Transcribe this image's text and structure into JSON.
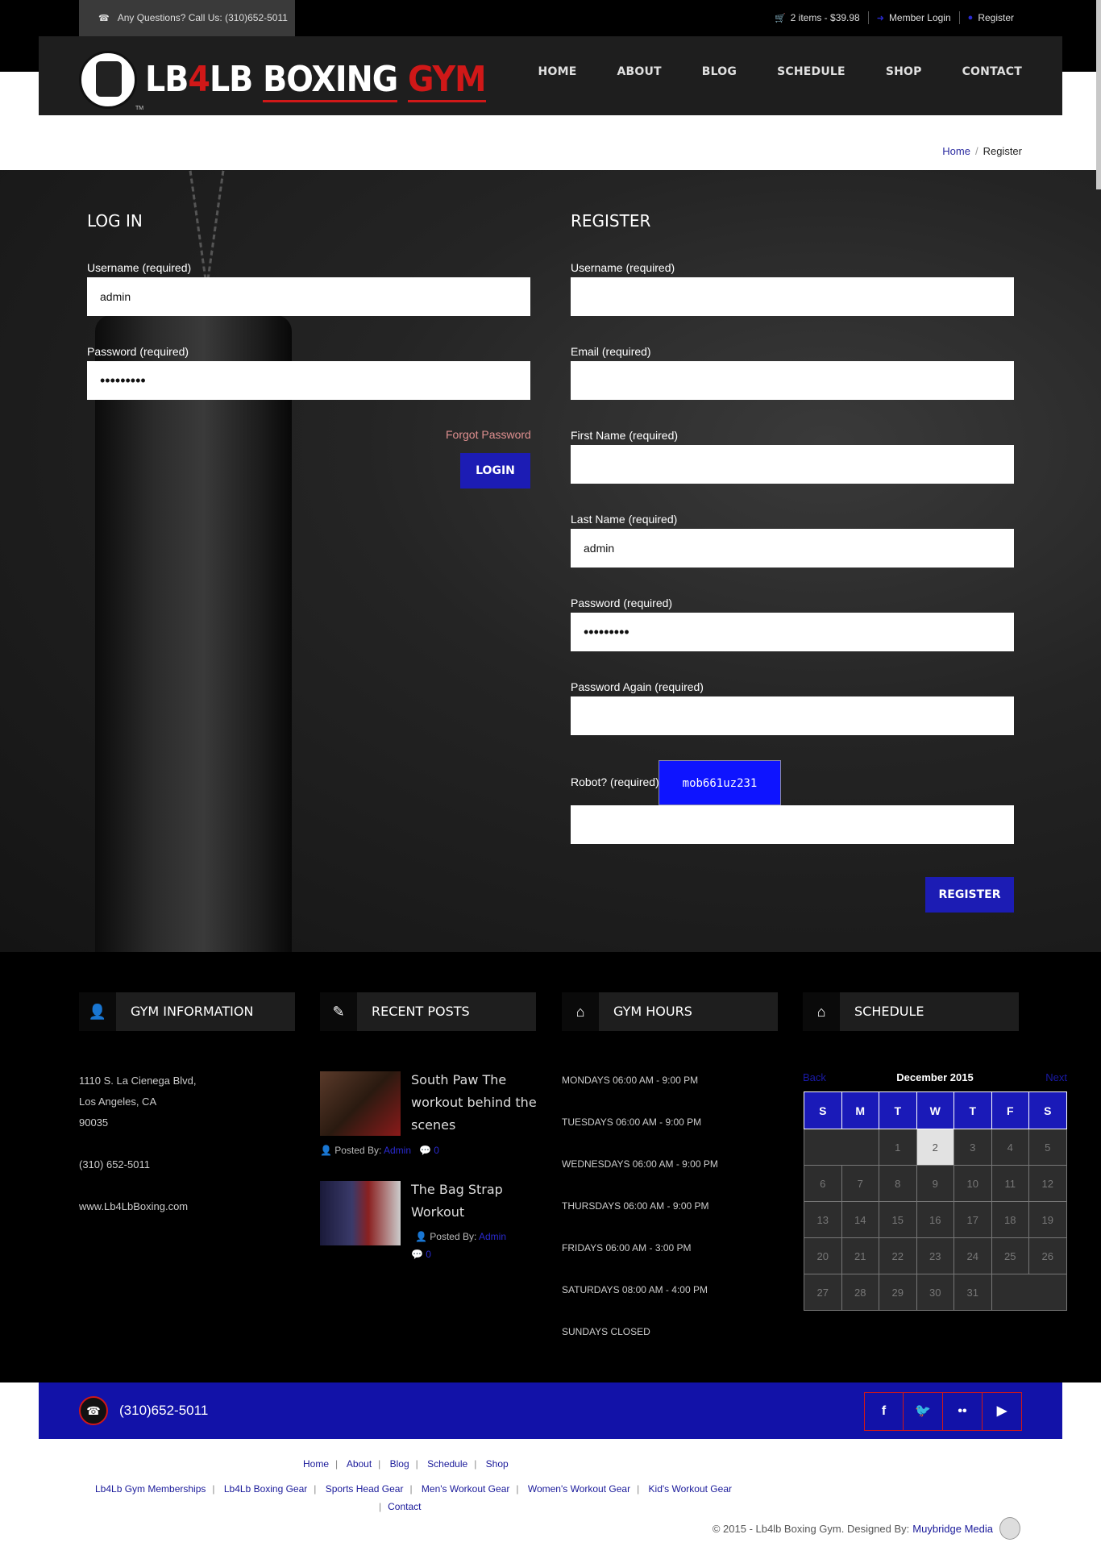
{
  "topbar": {
    "call_text": "Any Questions? Call Us: (310)652-5011",
    "cart_text": "2 items - $39.98",
    "member_login": "Member Login",
    "register": "Register"
  },
  "header": {
    "logo_prefix": "LB",
    "logo_four": "4",
    "logo_mid": "LB ",
    "logo_boxing": "BOXING",
    "logo_gym": "GYM",
    "logo_tm": "TM",
    "nav": [
      "HOME",
      "ABOUT",
      "BLOG",
      "SCHEDULE",
      "SHOP",
      "CONTACT"
    ]
  },
  "breadcrumb": {
    "home": "Home",
    "sep": "/",
    "current": "Register"
  },
  "login": {
    "title": "LOG IN",
    "username_label": "Username (required)",
    "username_value": "admin",
    "password_label": "Password (required)",
    "password_value": "•••••••••",
    "forgot": "Forgot Password",
    "button": "LOGIN"
  },
  "register": {
    "title": "REGISTER",
    "username_label": "Username (required)",
    "email_label": "Email (required)",
    "firstname_label": "First Name (required)",
    "lastname_label": "Last Name (required)",
    "lastname_value": "admin",
    "password_label": "Password (required)",
    "password_value": "•••••••••",
    "password_again_label": "Password Again (required)",
    "robot_label": "Robot? (required)",
    "captcha": "mob661uz231",
    "button": "REGISTER"
  },
  "widgets": {
    "info": {
      "title": "GYM INFORMATION",
      "address1": "1110 S. La Cienega Blvd,",
      "address2": "Los Angeles, CA",
      "zip": "90035",
      "phone": "(310) 652-5011",
      "web": "www.Lb4LbBoxing.com"
    },
    "posts": {
      "title": "RECENT POSTS",
      "items": [
        {
          "title_l1": "South Paw The",
          "title_l2": "workout behind the",
          "title_l3": "scenes",
          "posted_by": "Posted By:",
          "author": "Admin",
          "comments": "0"
        },
        {
          "title_l1": "The Bag Strap",
          "title_l2": "Workout",
          "posted_by": "Posted By:",
          "author": "Admin",
          "comments": "0"
        }
      ]
    },
    "hours": {
      "title": "GYM HOURS",
      "rows": [
        "MONDAYS 06:00 AM - 9:00 PM",
        "TUESDAYS 06:00 AM - 9:00 PM",
        "WEDNESDAYS 06:00 AM - 9:00 PM",
        "THURSDAYS 06:00 AM - 9:00 PM",
        "FRIDAYS 06:00 AM - 3:00 PM",
        "SATURDAYS 08:00 AM - 4:00 PM",
        "SUNDAYS CLOSED"
      ]
    },
    "schedule": {
      "title": "SCHEDULE",
      "back": "Back",
      "month": "December  2015",
      "next": "Next",
      "days": [
        "S",
        "M",
        "T",
        "W",
        "T",
        "F",
        "S"
      ],
      "weeks": [
        [
          "",
          "",
          "1",
          "2",
          "3",
          "4",
          "5"
        ],
        [
          "6",
          "7",
          "8",
          "9",
          "10",
          "11",
          "12"
        ],
        [
          "13",
          "14",
          "15",
          "16",
          "17",
          "18",
          "19"
        ],
        [
          "20",
          "21",
          "22",
          "23",
          "24",
          "25",
          "26"
        ],
        [
          "27",
          "28",
          "29",
          "30",
          "31",
          ""
        ]
      ],
      "today": "2"
    }
  },
  "bluebar": {
    "phone": "(310)652-5011",
    "social": [
      "f",
      "t",
      "fl",
      "yt"
    ]
  },
  "footer": {
    "row1": [
      "Home",
      "About",
      "Blog",
      "Schedule",
      "Shop"
    ],
    "row2": [
      "Lb4Lb Gym Memberships",
      "Lb4Lb Boxing Gear",
      "Sports Head Gear",
      "Men's Workout Gear",
      "Women's Workout Gear",
      "Kid's Workout Gear"
    ],
    "row3": [
      "Contact"
    ],
    "copyright": "© 2015 - Lb4lb Boxing Gym. Designed By:",
    "developer": "Muybridge Media"
  },
  "colors": {
    "accent_blue": "#1c1cb4",
    "accent_red": "#d01818"
  }
}
